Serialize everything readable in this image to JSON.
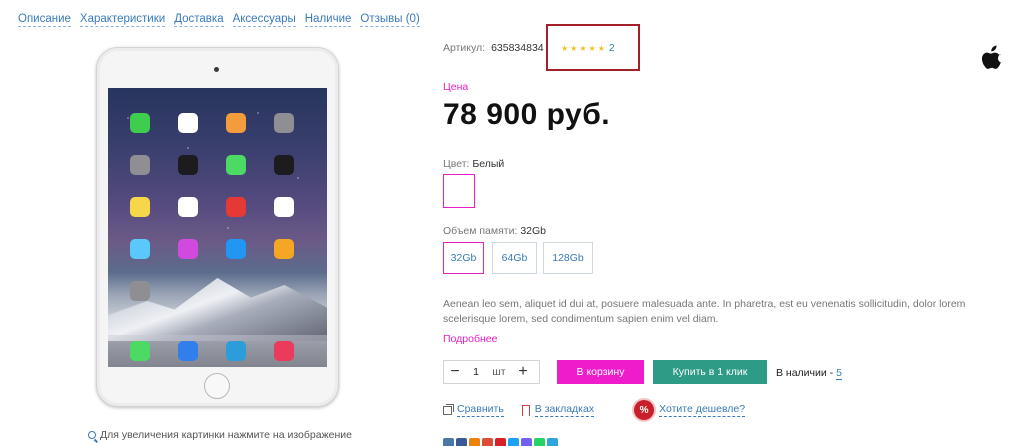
{
  "nav": {
    "tabs": [
      "Описание",
      "Характеристики",
      "Доставка",
      "Аксессуары",
      "Наличие",
      "Отзывы (0)"
    ]
  },
  "gallery": {
    "zoom_hint": "Для увеличения картинки нажмите на изображение",
    "zoom_icon": "search-icon"
  },
  "product": {
    "sku_label": "Артикул:",
    "sku_value": "635834834",
    "rating": {
      "stars_filled": 5,
      "stars_total": 5,
      "count": "2"
    },
    "brand_icon": "apple-logo-icon",
    "price_label": "Цена",
    "price": "78 900 руб.",
    "color_label": "Цвет:",
    "color_value": "Белый",
    "color_swatch": "#ffffff",
    "memory_label": "Объем памяти:",
    "memory_value": "32Gb",
    "memory_options": [
      "32Gb",
      "64Gb",
      "128Gb"
    ],
    "memory_selected": "32Gb",
    "description": "Aenean leo sem, aliquet id dui at, posuere malesuada ante. In pharetra, est eu venenatis sollicitudin, dolor lorem scelerisque lorem, sed condimentum sapien enim vel diam.",
    "more_link": "Подробнее"
  },
  "purchase": {
    "qty_value": "1",
    "qty_unit": "шт",
    "cart_button": "В корзину",
    "one_click_button": "Купить в 1 клик",
    "stock_label": "В наличии -",
    "stock_count": "5"
  },
  "actions": {
    "compare": "Сравнить",
    "bookmarks": "В закладках",
    "cheaper": "Хотите дешевле?",
    "cheaper_badge": "%"
  },
  "colors": {
    "accent_pink": "#e91ec6",
    "accent_green": "#2e9b86",
    "link_blue": "#3a7ab8",
    "highlight_red": "#a3202a",
    "star_yellow": "#f2c224"
  }
}
